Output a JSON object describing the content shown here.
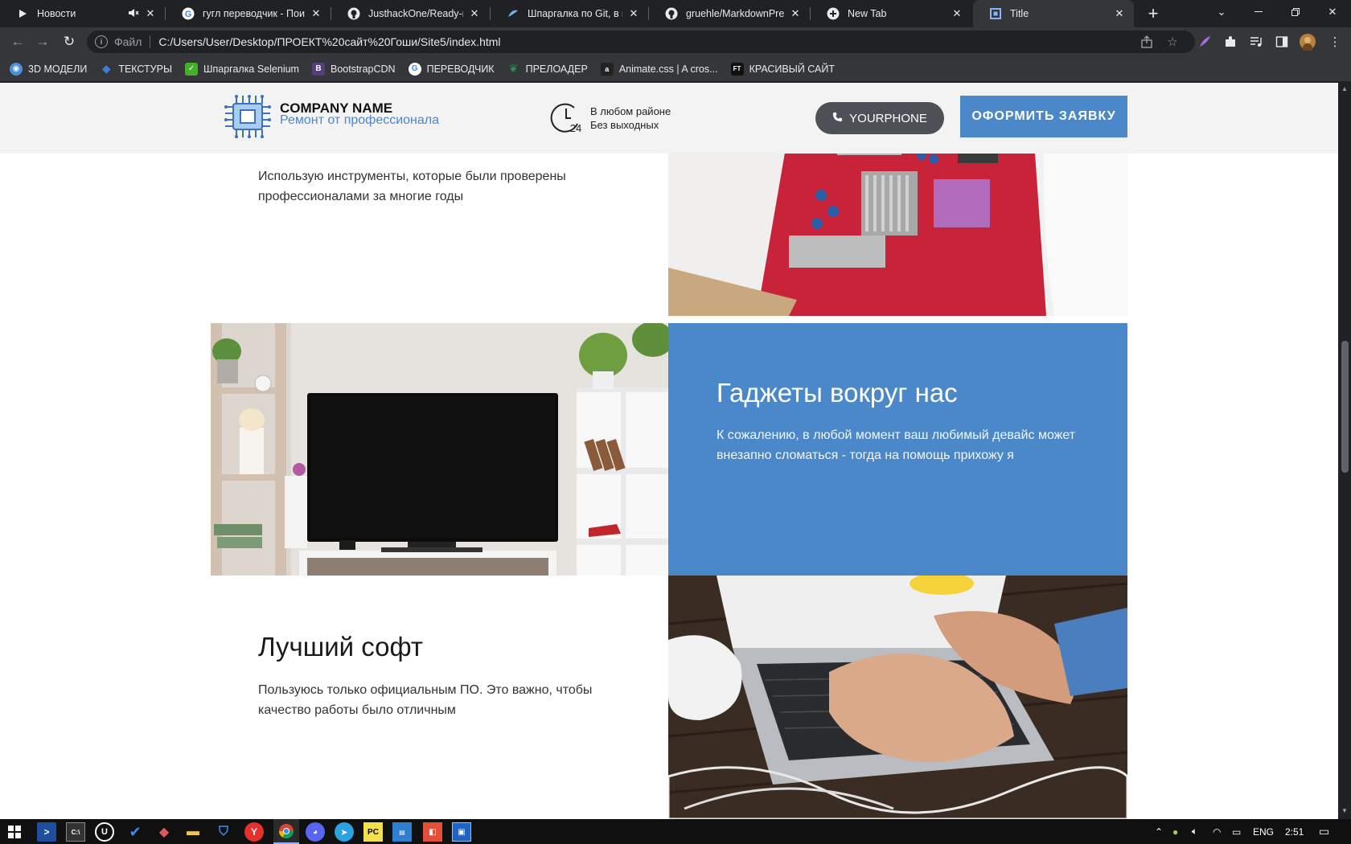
{
  "browser": {
    "tabs": [
      {
        "title": "Новости",
        "icon": "play-icon",
        "muted": true
      },
      {
        "title": "гугл переводчик - Поиск",
        "icon": "google-icon"
      },
      {
        "title": "JusthackOne/Ready-made",
        "icon": "github-icon"
      },
      {
        "title": "Шпаргалка по Git, в кото",
        "icon": "git-icon"
      },
      {
        "title": "gruehle/MarkdownPrevie",
        "icon": "github-icon"
      },
      {
        "title": "New Tab",
        "icon": "chrome-newtab-icon"
      },
      {
        "title": "Title",
        "icon": "page-icon",
        "active": true
      }
    ],
    "address": {
      "scheme": "Файл",
      "url": "C:/Users/User/Desktop/ПРОЕКТ%20сайт%20Гоши/Site5/index.html"
    },
    "bookmarks": [
      {
        "label": "3D МОДЕЛИ",
        "icon": "globe-icon",
        "color": "#4a90d9"
      },
      {
        "label": "ТЕКСТУРЫ",
        "icon": "cube-icon",
        "color": "#3b7dd8"
      },
      {
        "label": "Шпаргалка Selenium",
        "icon": "selenium-icon",
        "color": "#43b02a"
      },
      {
        "label": "BootstrapCDN",
        "icon": "bootstrap-icon",
        "color": "#563d7c"
      },
      {
        "label": "ПЕРЕВОДЧИК",
        "icon": "google-icon",
        "color": "#4285f4"
      },
      {
        "label": "ПРЕЛОАДЕР",
        "icon": "leaf-icon",
        "color": "#2e8b57"
      },
      {
        "label": "Animate.css | A cros...",
        "icon": "animate-icon",
        "color": "#222222"
      },
      {
        "label": "КРАСИВЫЙ САЙТ",
        "icon": "ft-icon",
        "color": "#111111"
      }
    ]
  },
  "site": {
    "company_name": "COMPANY NAME",
    "slogan": "Ремонт от профессионала",
    "area_line1": "В любом районе",
    "area_line2": "Без выходных",
    "clock_label": "24",
    "phone_label": "YOURPHONE",
    "order_label": "ОФОРМИТЬ ЗАЯВКУ",
    "accent_color": "#4a88c9",
    "section1": {
      "text": "Использую инструменты, которые были проверены профессионалами за многие годы"
    },
    "section2": {
      "heading": "Гаджеты вокруг нас",
      "text": "К сожалению, в любой момент ваш любимый девайс может внезапно сломаться - тогда на помощь прихожу я"
    },
    "section3": {
      "heading": "Лучший софт",
      "text": "Пользуюсь только официальным ПО. Это важно, чтобы качество работы было отличным"
    }
  },
  "taskbar": {
    "tray_lang": "ENG",
    "tray_time": "2:51"
  }
}
